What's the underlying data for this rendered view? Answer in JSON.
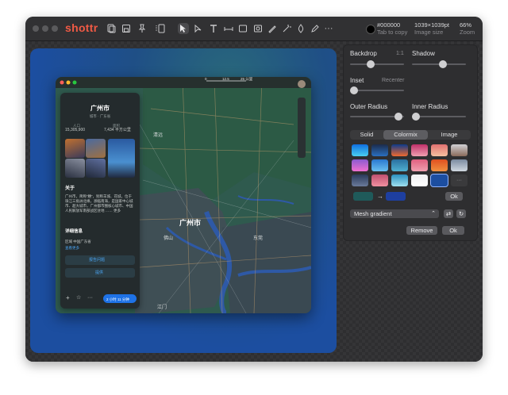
{
  "app": {
    "name": "shottr"
  },
  "toolbar": {
    "color_hex": "#000000",
    "color_hint": "Tab to copy",
    "image_size": "1039×1039pt",
    "image_size_label": "Image size",
    "zoom": "66%",
    "zoom_label": "Zoom",
    "more": "···"
  },
  "map": {
    "city": "广州市",
    "scale_labels": [
      "0",
      "12.5",
      "25 公里"
    ],
    "places": [
      {
        "name": "清远",
        "cls": "p1"
      },
      {
        "name": "广州市",
        "cls": "p2"
      },
      {
        "name": "佛山",
        "cls": "p3"
      },
      {
        "name": "东莞",
        "cls": "p4"
      },
      {
        "name": "江门",
        "cls": "p5"
      }
    ]
  },
  "place_panel": {
    "title": "广州市",
    "subtitle": "城市 · 广东省",
    "stat1_label": "人口",
    "stat1_value": "15,305,900",
    "stat2_label": "面积",
    "stat2_value": "7,434 平方公里",
    "about_heading": "关于",
    "about_text": "广州市，简称“穗”，别称羊城、花城，位于珠江三角洲北缘，濒临南海，是国家中心城市、超大城市，广州都市圈核心城市、中国人民解放军南部战区驻地 …… 更多",
    "details_heading": "详细信息",
    "details_line1": "区域   中国广东省",
    "details_line2": "查看更多",
    "report_label": "报告问题",
    "share_label": "提供",
    "directions_label": "2 小时 11 分钟"
  },
  "panel": {
    "backdrop_label": "Backdrop",
    "backdrop_ratio": "1:1",
    "shadow_label": "Shadow",
    "inset_label": "Inset",
    "recenter_label": "Recenter",
    "outer_radius_label": "Outer Radius",
    "inner_radius_label": "Inner Radius",
    "tabs": [
      "Solid",
      "Colormix",
      "Image"
    ],
    "active_tab": "Colormix",
    "ok_small": "Ok",
    "arrow": "→",
    "mesh_option": "Mesh gradient",
    "remove_label": "Remove",
    "ok_label": "Ok",
    "more_swatch": "···",
    "slider_levels": {
      "backdrop": 0.37,
      "shadow": 0.58,
      "inset": 0.0,
      "outer_radius": 0.97,
      "inner_radius": 0.0
    },
    "color_from": "#1f5a5a",
    "color_to": "#1e3fa0",
    "gradients": [
      [
        "#0f6fe0",
        "#4ad0f0"
      ],
      [
        "#1c2b4a",
        "#2a6fc0"
      ],
      [
        "#0d3a8a",
        "#f06a30"
      ],
      [
        "#c0306a",
        "#f0a0b0"
      ],
      [
        "#e07070",
        "#f5c0a0"
      ],
      [
        "#d0d0d4",
        "#8a6a5a"
      ],
      [
        "#8a5ad0",
        "#f070d0"
      ],
      [
        "#2a78d0",
        "#6ac0f0"
      ],
      [
        "#2a70a0",
        "#50b0d0"
      ],
      [
        "#e06080",
        "#f0a0b0"
      ],
      [
        "#e05020",
        "#f09040"
      ],
      [
        "#7a8aa0",
        "#d0d8e0"
      ],
      [
        "#2a3a5a",
        "#6a7a9a"
      ],
      [
        "#c05070",
        "#f090a0"
      ],
      [
        "#2a90c0",
        "#a0e0f0"
      ],
      [
        "#f0f0f2",
        "#ffffff"
      ],
      [
        "#1c4ea0",
        "#1c4ea0"
      ],
      [
        "#3a3a3c",
        "#3a3a3c"
      ]
    ]
  }
}
